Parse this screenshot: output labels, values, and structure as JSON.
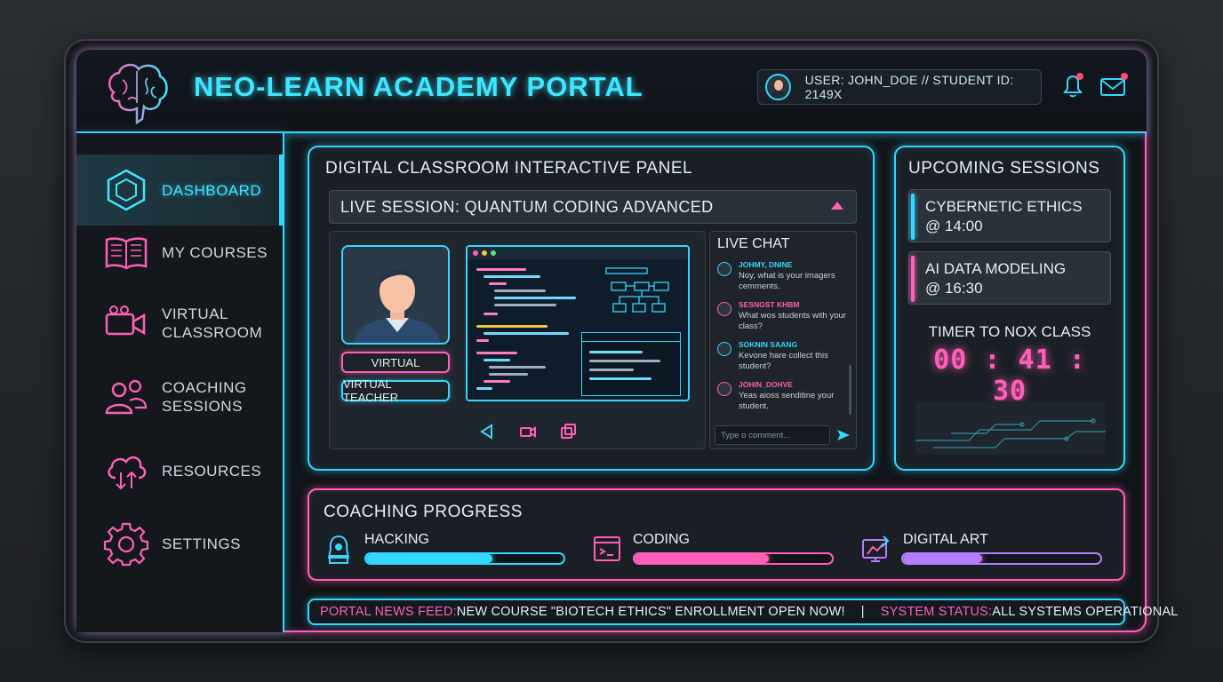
{
  "app": {
    "title": "NEO-LEARN ACADEMY PORTAL"
  },
  "user": {
    "label": "USER: JOHN_DOE // STUDENT ID: 2149X"
  },
  "sidebar": {
    "items": [
      {
        "label": "DASHBOARD",
        "icon": "hexagon-icon",
        "active": true
      },
      {
        "label": "MY COURSES",
        "icon": "book-icon"
      },
      {
        "label": "VIRTUAL CLASSROOM",
        "icon": "video-camera-icon"
      },
      {
        "label": "COACHING SESSIONS",
        "icon": "people-icon"
      },
      {
        "label": "RESOURCES",
        "icon": "cloud-sync-icon"
      },
      {
        "label": "SETTINGS",
        "icon": "gear-icon"
      }
    ]
  },
  "classroom": {
    "title": "DIGITAL CLASSROOM INTERACTIVE PANEL",
    "live_session": "LIVE SESSION: QUANTUM CODING ADVANCED",
    "virtual_label": "VIRTUAL",
    "teacher_label": "VIRTUAL TEACHER",
    "chat": {
      "title": "LIVE CHAT",
      "messages": [
        {
          "name": "JOHMY, DNINE",
          "text": "Noy, what is your imagers cemments.",
          "color": "#35d6ff"
        },
        {
          "name": "SESNGST KHBM",
          "text": "What wos students with your class?",
          "color": "#ff5fb8"
        },
        {
          "name": "SOKNIN SAANG",
          "text": "Kevone hare collect this student?",
          "color": "#35d6ff"
        },
        {
          "name": "JOHIN_DOHVE",
          "text": "Yeas aioss senditine your student.",
          "color": "#ff5fb8"
        }
      ],
      "placeholder": "Type o comment..."
    }
  },
  "sessions": {
    "title": "UPCOMING SESSIONS",
    "items": [
      {
        "name": "CYBERNETIC ETHICS",
        "time": "@ 14:00",
        "accent": "#35d6ff"
      },
      {
        "name": "AI DATA MODELING",
        "time": "@ 16:30",
        "accent": "#ff5fb8"
      }
    ],
    "timer_label": "TIMER TO NOX CLASS",
    "timer_value": "00 : 41 : 30"
  },
  "progress": {
    "title": "COACHING PROGRESS",
    "skills": [
      {
        "label": "HACKING",
        "value": 0.64,
        "color": "#35d6ff",
        "icon": "hacker-icon"
      },
      {
        "label": "CODING",
        "value": 0.68,
        "color": "#ff5fb8",
        "icon": "terminal-icon"
      },
      {
        "label": "DIGITAL ART",
        "value": 0.4,
        "color": "#b57cff",
        "icon": "drawing-tablet-icon"
      }
    ]
  },
  "footer": {
    "news_key": "PORTAL NEWS FEED:",
    "news_value": " NEW COURSE \"BIOTECH ETHICS\" ENROLLMENT OPEN NOW!",
    "separator": "|",
    "status_key": "SYSTEM STATUS:",
    "status_value": " ALL SYSTEMS OPERATIONAL"
  }
}
